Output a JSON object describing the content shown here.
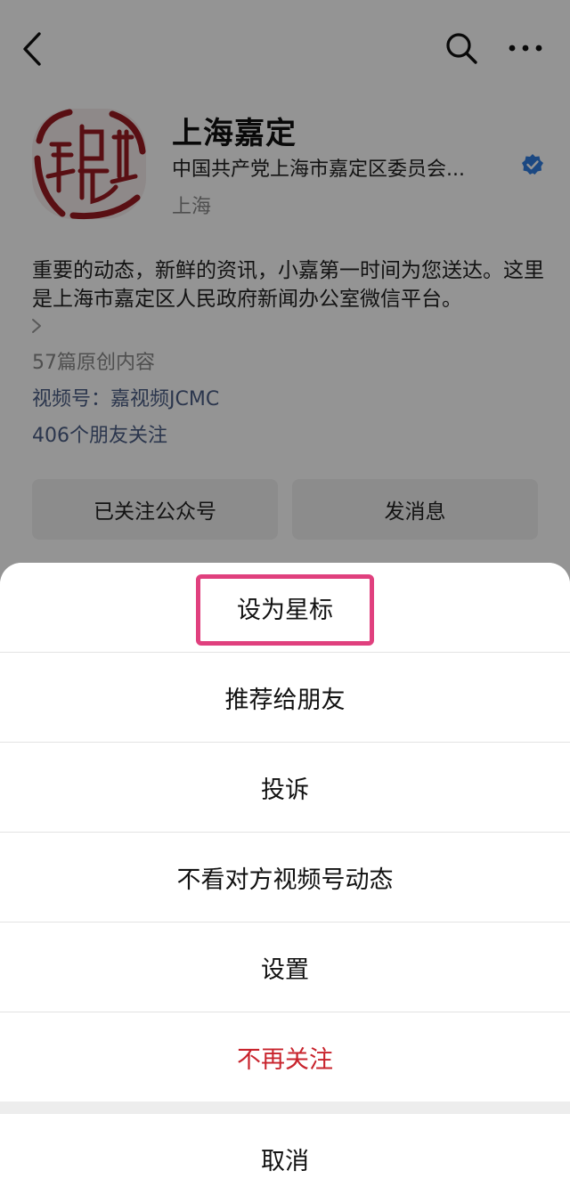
{
  "account": {
    "name": "上海嘉定",
    "org": "中国共产党上海市嘉定区委员会...",
    "location": "上海",
    "description": "重要的动态，新鲜的资讯，小嘉第一时间为您送达。这里是上海市嘉定区人民政府新闻办公室微信平台。",
    "original_count": "57篇原创内容",
    "channel": "视频号：嘉视频JCMC",
    "friends_follow": "406个朋友关注"
  },
  "buttons": {
    "followed": "已关注公众号",
    "message": "发消息"
  },
  "sheet": {
    "items": [
      {
        "label": "设为星标"
      },
      {
        "label": "推荐给朋友"
      },
      {
        "label": "投诉"
      },
      {
        "label": "不看对方视频号动态"
      },
      {
        "label": "设置"
      },
      {
        "label": "不再关注"
      }
    ],
    "cancel": "取消"
  },
  "colors": {
    "link": "#4b5d86",
    "danger": "#c8232c",
    "highlight": "#e0407e",
    "verified": "#2f7de1"
  }
}
